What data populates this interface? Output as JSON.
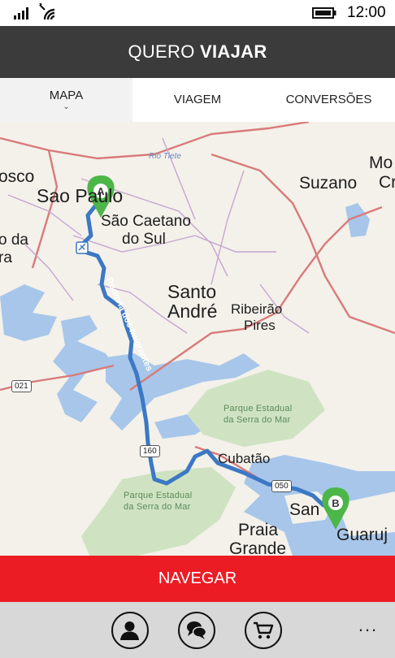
{
  "status_bar": {
    "time": "12:00"
  },
  "header": {
    "title_light": "QUERO",
    "title_bold": "VIAJAR"
  },
  "tabs": [
    {
      "label": "MAPA",
      "selected": true
    },
    {
      "label": "VIAGEM",
      "selected": false
    },
    {
      "label": "CONVERSÕES",
      "selected": false
    }
  ],
  "map": {
    "origin_marker": "A",
    "destination_marker": "B",
    "places": {
      "sao_paulo": "Sao Paulo",
      "sao_caetano": "São Caetano",
      "do_sul": "do Sul",
      "santo": "Santo",
      "andre": "André",
      "ribeirao": "Ribeirão",
      "pires": "Pires",
      "suzano": "Suzano",
      "mo": "Mo",
      "cr": "Cr",
      "osco": "osco",
      "o_da": "o da",
      "ra": "ra",
      "cubatao": "Cubatão",
      "praia": "Praia",
      "grande": "Grande",
      "san": "San",
      "guaruj": "Guaruj"
    },
    "parks": {
      "serra_mar_1": [
        "Parque Estadual",
        "da Serra do Mar"
      ],
      "serra_mar_2": [
        "Parque Estadual",
        "da Serra do Mar"
      ]
    },
    "river": "Rio Tiete",
    "road_name": "Rodovia dos Imigrantes",
    "shields": {
      "s021": "021",
      "s160": "160",
      "s050": "050"
    },
    "colors": {
      "route": "#3c78c4",
      "water": "#a7c6ea",
      "park": "#cfe3c2",
      "marker": "#4cb648"
    }
  },
  "navigate_label": "NAVEGAR",
  "app_bar": {
    "buttons": [
      {
        "icon": "person-icon"
      },
      {
        "icon": "chat-icon"
      },
      {
        "icon": "cart-icon"
      }
    ],
    "more": "..."
  }
}
